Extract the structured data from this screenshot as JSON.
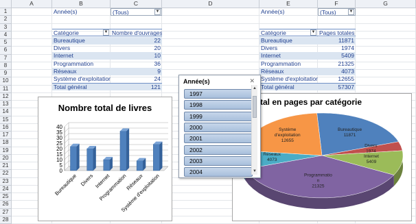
{
  "columns": [
    "A",
    "B",
    "C",
    "D",
    "E",
    "F",
    "G"
  ],
  "rows": [
    "1",
    "2",
    "3",
    "4",
    "5",
    "6",
    "7",
    "8",
    "9",
    "10",
    "11",
    "12",
    "13",
    "14",
    "15",
    "16",
    "17",
    "18",
    "19",
    "20",
    "21",
    "22",
    "23",
    "24",
    "25",
    "26",
    "27",
    "28"
  ],
  "pivot1": {
    "filter_label": "Année(s)",
    "filter_value": "(Tous)",
    "header_category": "Catégorie",
    "header_value": "Nombre d'ouvrages",
    "rows": [
      {
        "label": "Bureautique",
        "value": "22"
      },
      {
        "label": "Divers",
        "value": "20"
      },
      {
        "label": "Internet",
        "value": "10"
      },
      {
        "label": "Programmation",
        "value": "36"
      },
      {
        "label": "Réseaux",
        "value": "9"
      },
      {
        "label": "Système d'exploitation",
        "value": "24"
      }
    ],
    "total_label": "Total général",
    "total_value": "121"
  },
  "pivot2": {
    "filter_label": "Année(s)",
    "filter_value": "(Tous)",
    "header_category": "Catégorie",
    "header_value": "Pages totales",
    "rows": [
      {
        "label": "Bureautique",
        "value": "11871"
      },
      {
        "label": "Divers",
        "value": "1974"
      },
      {
        "label": "Internet",
        "value": "5409"
      },
      {
        "label": "Programmation",
        "value": "21325"
      },
      {
        "label": "Réseaux",
        "value": "4073"
      },
      {
        "label": "Système d'exploitation",
        "value": "12655"
      }
    ],
    "total_label": "Total général",
    "total_value": "57307"
  },
  "slicer": {
    "title": "Année(s)",
    "items": [
      "1997",
      "1998",
      "1999",
      "2000",
      "2001",
      "2002",
      "2003",
      "2004"
    ]
  },
  "chart_data": [
    {
      "type": "bar",
      "title": "Nombre total de livres",
      "categories": [
        "Bureautique",
        "Divers",
        "Internet",
        "Programmation",
        "Réseaux",
        "Système d'exploitation"
      ],
      "values": [
        22,
        20,
        10,
        36,
        9,
        24
      ],
      "yticks": [
        "0",
        "5",
        "10",
        "15",
        "20",
        "25",
        "30",
        "35",
        "40"
      ],
      "ylim": [
        0,
        40
      ],
      "color": "#4f81bd"
    },
    {
      "type": "pie",
      "title": "tal en pages par catégorie",
      "categories": [
        "Bureautique",
        "Divers",
        "Internet",
        "Programmation",
        "Réseaux",
        "Système d'exploitation"
      ],
      "values": [
        11871,
        1974,
        5409,
        21325,
        4073,
        12655
      ],
      "label_lines": [
        [
          "Bureautique",
          "11871"
        ],
        [
          "Divers",
          "1974"
        ],
        [
          "Internet",
          "5409"
        ],
        [
          "Programmatio",
          "n",
          "21325"
        ],
        [
          "Réseaux",
          "4073"
        ],
        [
          "Système",
          "d'exploitation",
          "12655"
        ]
      ],
      "colors": [
        "#4f81bd",
        "#c0504d",
        "#9bbb59",
        "#8064a2",
        "#4bacc6",
        "#f79646"
      ]
    }
  ]
}
